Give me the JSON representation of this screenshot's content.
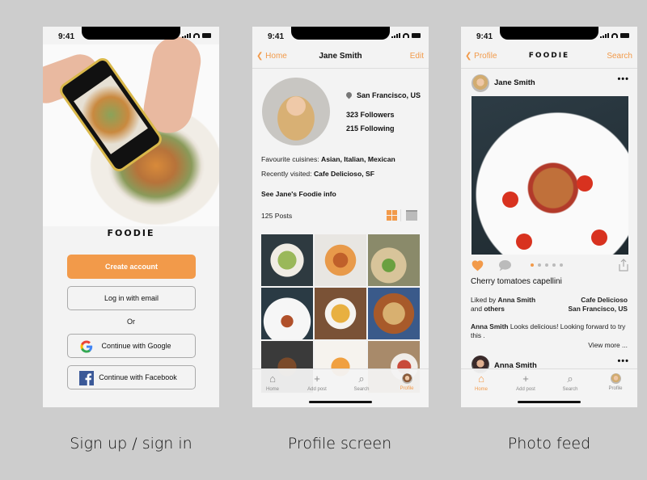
{
  "status_time": "9:41",
  "colors": {
    "accent": "#f29a4a",
    "background": "#cdcdcd",
    "screen": "#f3f3f3"
  },
  "signup": {
    "logo": "FOODIE",
    "create_account": "Create account",
    "login_email": "Log in with email",
    "or": "Or",
    "google": "Continue with Google",
    "facebook": "Continue with Facebook",
    "google_icon": "google-logo-icon",
    "facebook_icon": "facebook-logo-icon"
  },
  "profile": {
    "nav": {
      "back": "Home",
      "title": "Jane Smith",
      "right": "Edit"
    },
    "location": "San Francisco, US",
    "followers": "323 Followers",
    "following": "215 Following",
    "fav_label": "Favourite cuisines:",
    "fav_value": "Asian, Italian, Mexican",
    "visited_label": "Recently visited:",
    "visited_value": "Cafe Delicioso, SF",
    "foodie_info": "See Jane's Foodie info",
    "posts": "125 Posts",
    "grid_photos": [
      "salad bowl",
      "pizza",
      "tacos",
      "pasta",
      "dumpling soup",
      "nachos",
      "grilled dish",
      "omelette",
      "sushi"
    ]
  },
  "feed": {
    "nav": {
      "back": "Profile",
      "title": "FOODIE",
      "right": "Search"
    },
    "post_author": "Jane Smith",
    "caption": "Cherry tomatoes capellini",
    "liked_prefix": "Liked by",
    "liked_name": "Anna Smith",
    "liked_and": "and",
    "liked_others": "others",
    "place_name": "Cafe Delicioso",
    "place_city": "San Francisco, US",
    "comment_author": "Anna Smith",
    "comment_text": "Looks delicious! Looking forward to try this .",
    "view_more": "View more ...",
    "next_author": "Anna Smith",
    "carousel_count": 5,
    "carousel_active": 1
  },
  "tabbar": {
    "home": "Home",
    "add": "Add post",
    "search": "Search",
    "profile": "Profile"
  },
  "labels": {
    "signup": "Sign up / sign in",
    "profile": "Profile screen",
    "feed": "Photo feed"
  }
}
